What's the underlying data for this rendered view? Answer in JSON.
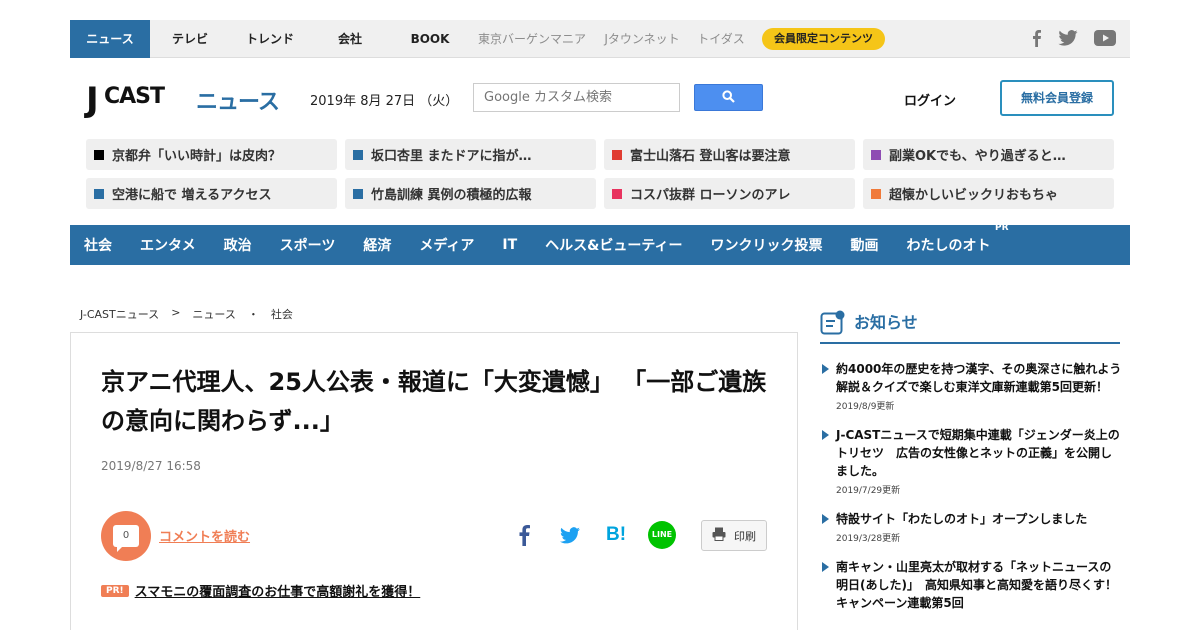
{
  "topnav": {
    "items": [
      {
        "label": "ニュース",
        "active": true
      },
      {
        "label": "テレビ"
      },
      {
        "label": "トレンド"
      },
      {
        "label": "会社"
      },
      {
        "label": "BOOK"
      }
    ],
    "external": [
      {
        "label": "東京バーゲンマニア"
      },
      {
        "label": "Jタウンネット"
      },
      {
        "label": "トイダス"
      }
    ],
    "member_label": "会員限定コンテンツ",
    "social_icons": [
      "facebook-icon",
      "twitter-icon",
      "youtube-icon"
    ]
  },
  "header": {
    "logo_j": "J",
    "logo_cast": "CAST",
    "logo_news": "ニュース",
    "date": "2019年 8月 27日 （火）",
    "search_placeholder": "Google カスタム検索",
    "login_label": "ログイン",
    "register_label": "無料会員登録"
  },
  "topics": [
    {
      "label": "京都弁「いい時計」は皮肉？",
      "color": "#000000"
    },
    {
      "label": "坂口杏里 またドアに指が…",
      "color": "#2a6ea3"
    },
    {
      "label": "富士山落石 登山客は要注意",
      "color": "#e03c31"
    },
    {
      "label": "副業OKでも、やり過ぎると…",
      "color": "#8e4bb3"
    },
    {
      "label": "空港に船で 増えるアクセス",
      "color": "#2a6ea3"
    },
    {
      "label": "竹島訓練 異例の積極的広報",
      "color": "#2a6ea3"
    },
    {
      "label": "コスパ抜群 ローソンのアレ",
      "color": "#e8335f"
    },
    {
      "label": "超懐かしいビックリおもちゃ",
      "color": "#f07a3a"
    }
  ],
  "categories": [
    {
      "label": "社会"
    },
    {
      "label": "エンタメ"
    },
    {
      "label": "政治"
    },
    {
      "label": "スポーツ"
    },
    {
      "label": "経済"
    },
    {
      "label": "メディア"
    },
    {
      "label": "IT"
    },
    {
      "label": "ヘルス&ビューティー"
    },
    {
      "label": "ワンクリック投票"
    },
    {
      "label": "動画"
    },
    {
      "label": "わたしのオト",
      "sup": "PR"
    }
  ],
  "breadcrumb": {
    "home": "J-CASTニュース",
    "sep": ">",
    "section": "ニュース",
    "dot": "・",
    "category": "社会"
  },
  "article": {
    "headline": "京アニ代理人、25人公表・報道に「大変遺憾」 「一部ご遺族の意向に関わらず...」",
    "date": "2019/8/27 16:58",
    "comment_count": "0",
    "comment_label": "コメントを読む",
    "share_icons": [
      "facebook-share-icon",
      "twitter-share-icon",
      "hatena-bookmark-icon",
      "line-icon"
    ],
    "line_label": "LINE",
    "hatena_label": "B!",
    "print_label": "印刷",
    "pr_badge": "PR!",
    "pr_link": "スマモニの覆面調査のお仕事で高額謝礼を獲得！"
  },
  "sidebar": {
    "notice_title": "お知らせ",
    "notices": [
      {
        "text": "約4000年の歴史を持つ漢字、その奥深さに触れよう　解説＆クイズで楽しむ東洋文庫新連載第5回更新！",
        "date": "2019/8/9更新"
      },
      {
        "text": "J-CASTニュースで短期集中連載「ジェンダー炎上のトリセツ　広告の女性像とネットの正義」を公開しました。",
        "date": "2019/7/29更新"
      },
      {
        "text": "特設サイト「わたしのオト」オープンしました",
        "date": "2019/3/28更新"
      },
      {
        "text": "南キャン・山里亮太が取材する「ネットニュースの明日(あした)」　高知県知事と高知愛を語り尽くす！キャンペーン連載第5回",
        "date": ""
      }
    ]
  },
  "colors": {
    "brand_blue": "#2a6ea3",
    "accent_orange": "#f07e55",
    "member_yellow": "#f5c518"
  }
}
